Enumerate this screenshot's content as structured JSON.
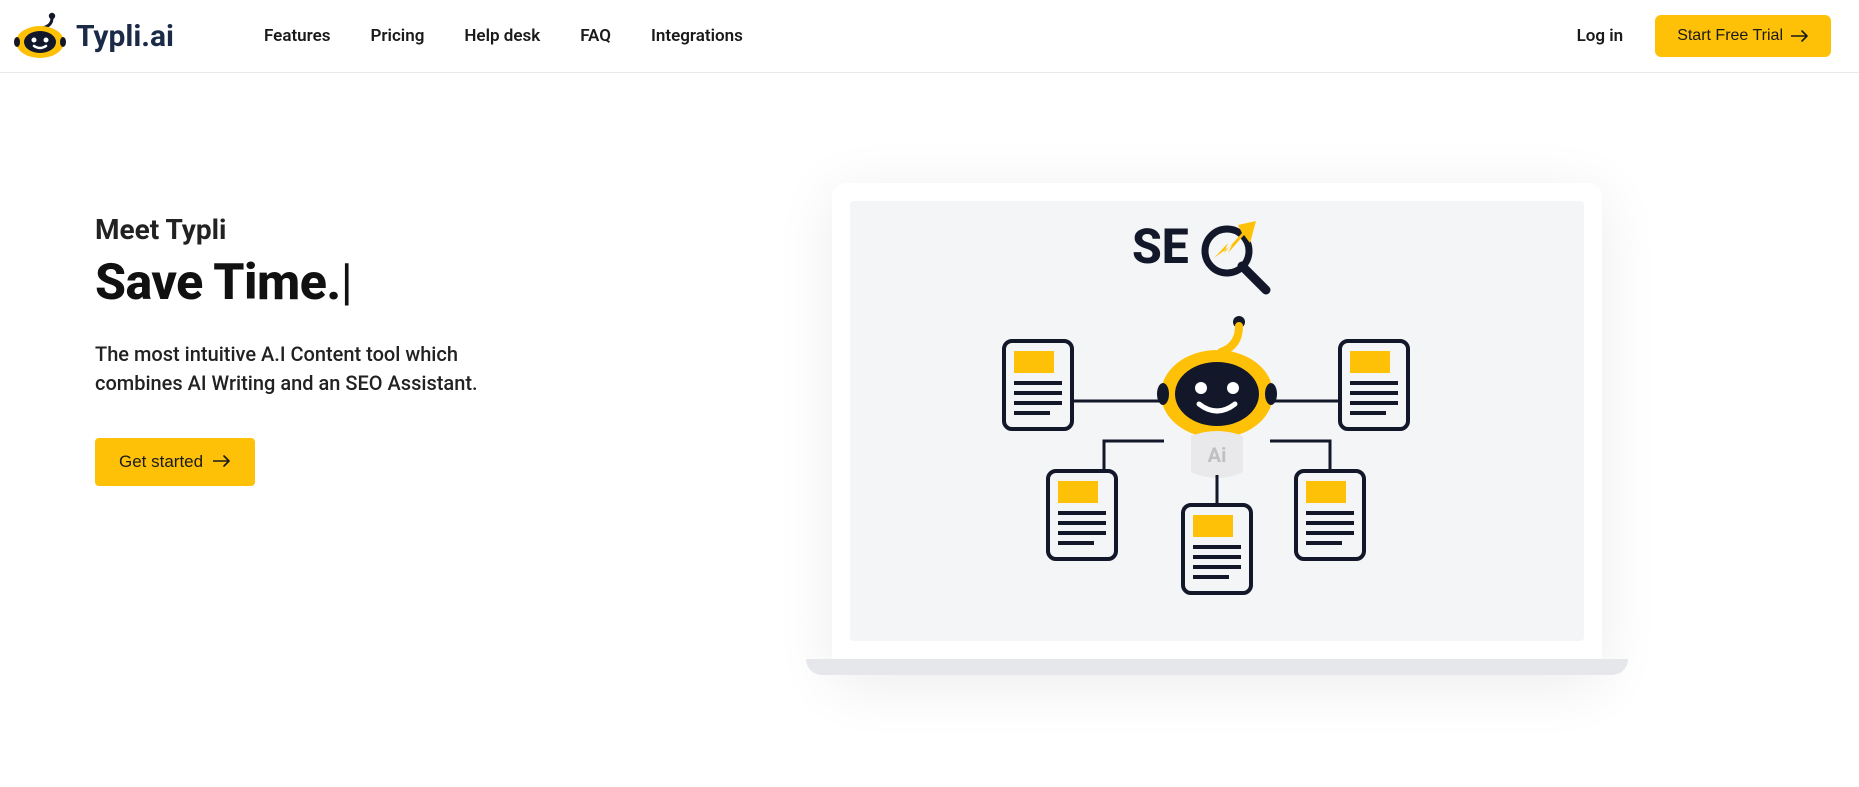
{
  "brand": {
    "name": "Typli.ai"
  },
  "nav": {
    "items": [
      {
        "label": "Features"
      },
      {
        "label": "Pricing"
      },
      {
        "label": "Help desk"
      },
      {
        "label": "FAQ"
      },
      {
        "label": "Integrations"
      }
    ]
  },
  "header": {
    "login_label": "Log in",
    "trial_label": "Start Free Trial"
  },
  "hero": {
    "eyebrow": "Meet Typli",
    "headline": "Save Time.",
    "cursor": "|",
    "subhead": "The most intuitive A.I Content tool which combines AI Writing and an SEO Assistant.",
    "cta_label": "Get started",
    "illustration": {
      "seo_text": "SE",
      "ai_badge": "Ai"
    }
  },
  "colors": {
    "accent": "#fec108",
    "ink": "#1a2a47"
  }
}
